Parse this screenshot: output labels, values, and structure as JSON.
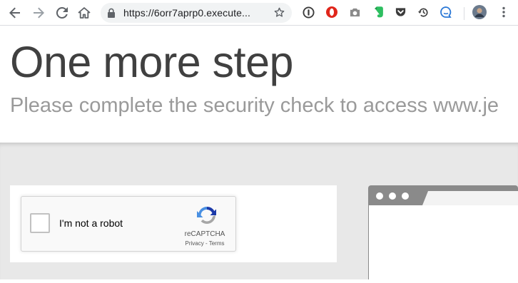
{
  "browser": {
    "url": "https://6orr7aprp0.execute...",
    "icons": {
      "back": "back-arrow-icon",
      "forward": "forward-arrow-icon",
      "reload": "reload-icon",
      "home": "home-icon",
      "lock": "lock-icon",
      "bookmark": "star-icon",
      "extensions": [
        "1password-icon",
        "opera-icon",
        "camera-icon",
        "evernote-icon",
        "pocket-icon",
        "history-icon",
        "chat-icon"
      ],
      "avatar": "avatar",
      "menu": "kebab-menu-icon"
    }
  },
  "page": {
    "title": "One more step",
    "subtitle": "Please complete the security check to access www.je"
  },
  "recaptcha": {
    "checkbox_label": "I'm not a robot",
    "brand": "reCAPTCHA",
    "privacy": "Privacy",
    "separator": " - ",
    "terms": "Terms"
  },
  "colors": {
    "content_bg": "#e8e8e8",
    "recaptcha_blue": "#4a90e2",
    "recaptcha_gray": "#a6a6a6",
    "illustration_gray": "#8a8a8a"
  }
}
